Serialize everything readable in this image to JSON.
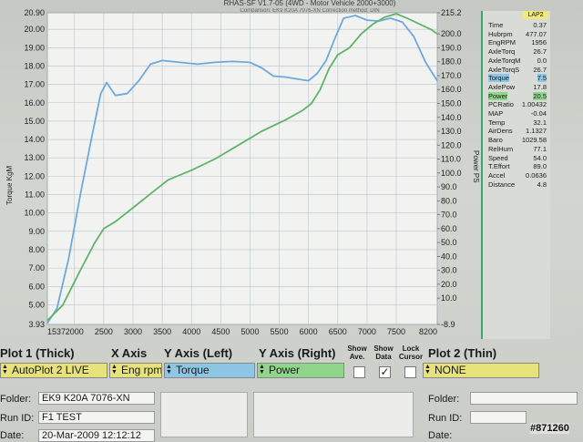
{
  "header": {
    "title": "RHAS-SF V1.7-05 (4WD - Motor Vehicle 2000+3000)",
    "subtitle": "Comparison: EK9 K20A 7076-XN   Correction method: DIN"
  },
  "chart_data": {
    "type": "line",
    "x_ticks": [
      "1537",
      "2000",
      "2500",
      "3000",
      "3500",
      "4000",
      "4500",
      "5000",
      "5500",
      "6000",
      "6500",
      "7000",
      "7500",
      "8200"
    ],
    "xlim": [
      1537,
      8200
    ],
    "y_left": {
      "label": "Torque KgM",
      "ticks": [
        "20.90",
        "20.00",
        "19.00",
        "18.00",
        "17.00",
        "16.00",
        "15.00",
        "14.00",
        "13.00",
        "12.00",
        "11.00",
        "10.00",
        "9.00",
        "8.00",
        "7.00",
        "6.00",
        "5.00",
        "3.93"
      ],
      "ylim": [
        3.93,
        20.9
      ],
      "color": "#6fa8dc"
    },
    "y_right": {
      "label": "Power PS",
      "ticks": [
        "215.2",
        "200.0",
        "190.0",
        "180.0",
        "170.0",
        "160.0",
        "150.0",
        "140.0",
        "130.0",
        "120.0",
        "110.0",
        "100.0",
        "90.0",
        "80.0",
        "70.0",
        "60.0",
        "50.0",
        "40.0",
        "30.0",
        "20.0",
        "10.0",
        "-8.9"
      ],
      "ylim": [
        -8.9,
        215.2
      ],
      "color": "#5fb36a"
    },
    "series": [
      {
        "name": "Torque",
        "axis": "left",
        "x": [
          1537,
          1700,
          1900,
          2100,
          2300,
          2450,
          2550,
          2700,
          2900,
          3100,
          3300,
          3500,
          3800,
          4100,
          4400,
          4700,
          5000,
          5200,
          5400,
          5600,
          5800,
          6000,
          6150,
          6300,
          6450,
          6600,
          6800,
          7000,
          7200,
          7400,
          7600,
          7800,
          8000,
          8200
        ],
        "y": [
          4.0,
          4.8,
          7.5,
          11.0,
          14.2,
          16.5,
          17.1,
          16.4,
          16.5,
          17.2,
          18.1,
          18.3,
          18.2,
          18.1,
          18.2,
          18.25,
          18.2,
          17.9,
          17.45,
          17.4,
          17.3,
          17.2,
          17.6,
          18.3,
          19.5,
          20.6,
          20.75,
          20.5,
          20.45,
          20.6,
          20.4,
          19.6,
          18.2,
          17.2
        ]
      },
      {
        "name": "Power",
        "axis": "right",
        "x": [
          1537,
          1800,
          2100,
          2350,
          2500,
          2700,
          3000,
          3300,
          3600,
          4000,
          4400,
          4800,
          5200,
          5600,
          5900,
          6050,
          6200,
          6350,
          6500,
          6700,
          6900,
          7100,
          7300,
          7500,
          7700,
          7900,
          8100,
          8200
        ],
        "y": [
          -6.0,
          5.0,
          30.0,
          50.0,
          60.0,
          65.0,
          75.0,
          85.0,
          95.0,
          102.0,
          110.0,
          120.0,
          130.0,
          138.0,
          145.0,
          150.0,
          160.0,
          175.0,
          185.0,
          190.0,
          200.0,
          207.0,
          212.0,
          214.5,
          211.0,
          207.0,
          203.0,
          200.0
        ]
      }
    ],
    "grid": true
  },
  "stats": {
    "header": "LAP2",
    "rows": [
      {
        "label": "Time",
        "value": "0.37",
        "hl": ""
      },
      {
        "label": "Hubrpm",
        "value": "477.07",
        "hl": ""
      },
      {
        "label": "EngRPM",
        "value": "1956",
        "hl": ""
      },
      {
        "label": "AxleTorq",
        "value": "26.7",
        "hl": ""
      },
      {
        "label": "AxleTorqM",
        "value": "0.0",
        "hl": ""
      },
      {
        "label": "AxleTorqS",
        "value": "26.7",
        "hl": ""
      },
      {
        "label": "Torque",
        "value": "7.5",
        "hl": "blue"
      },
      {
        "label": "AxlePow",
        "value": "17.8",
        "hl": ""
      },
      {
        "label": "Power",
        "value": "20.5",
        "hl": "green"
      },
      {
        "label": "PCRatio",
        "value": "1.00432",
        "hl": ""
      },
      {
        "label": "MAP",
        "value": "-0.04",
        "hl": ""
      },
      {
        "label": "Temp",
        "value": "32.1",
        "hl": ""
      },
      {
        "label": "AirDens",
        "value": "1.1327",
        "hl": ""
      },
      {
        "label": "Baro",
        "value": "1029.58",
        "hl": ""
      },
      {
        "label": "RelHum",
        "value": "77.1",
        "hl": ""
      },
      {
        "label": "Speed",
        "value": "54.0",
        "hl": ""
      },
      {
        "label": "T.Effort",
        "value": "89.0",
        "hl": ""
      },
      {
        "label": "Accel",
        "value": "0.0636",
        "hl": ""
      },
      {
        "label": "Distance",
        "value": "4.8",
        "hl": ""
      }
    ]
  },
  "controls": {
    "plot1_label": "Plot 1 (Thick)",
    "xaxis_label": "X Axis",
    "yleft_label": "Y Axis (Left)",
    "yright_label": "Y Axis (Right)",
    "show_ave_label": "Show Ave.",
    "show_data_label": "Show Data",
    "lock_cursor_label": "Lock Cursor",
    "plot2_label": "Plot 2 (Thin)",
    "plot1_value": "AutoPlot 2 LIVE",
    "xaxis_value": "Eng rpm",
    "yleft_value": "Torque",
    "yright_value": "Power",
    "plot2_value": "NONE",
    "show_ave_checked": false,
    "show_data_checked": true,
    "lock_cursor_checked": false,
    "check_mark": "✓"
  },
  "info": {
    "folder_label": "Folder:",
    "folder_value": "EK9 K20A 7076-XN",
    "runid_label": "Run ID:",
    "runid_value": "F1 TEST",
    "date_label": "Date:",
    "date_value": "20-Mar-2009  12:12:12",
    "folder2_label": "Folder:",
    "runid2_label": "Run ID:",
    "date2_label": "Date:"
  },
  "watermark": "#871260",
  "colors": {
    "grid": "#b9c3cc",
    "plot_bg": "#f2f3f1",
    "select_yellow": "#e8e27a",
    "select_blue": "#8ec7e6",
    "select_green": "#8fd68a"
  }
}
